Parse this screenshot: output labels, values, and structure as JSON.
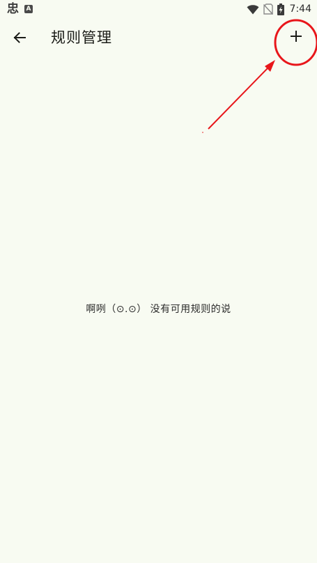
{
  "status_bar": {
    "app_glyph": "忠",
    "badge_letter": "A",
    "time": "7:44",
    "icons": [
      "wifi-icon",
      "no-sim-icon",
      "battery-charging-icon"
    ]
  },
  "app_bar": {
    "title": "规则管理",
    "back_icon": "arrow-left-icon",
    "add_icon": "plus-icon"
  },
  "empty_state": {
    "message": "啊咧（⊙.⊙） 没有可用规则的说"
  },
  "annotation": {
    "color": "#E8161B",
    "shapes": [
      "circle",
      "arrow"
    ]
  },
  "colors": {
    "background": "#F8FBF2",
    "text": "#1B1C18",
    "annotation": "#E8161B"
  }
}
